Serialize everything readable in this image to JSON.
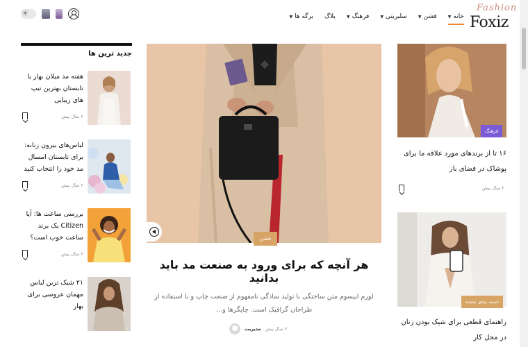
{
  "brand": {
    "logo_script": "Fashion",
    "logo_main": "Foxiz"
  },
  "nav": {
    "items": [
      {
        "label": "خانه",
        "has_dropdown": true,
        "active": true
      },
      {
        "label": "فشن",
        "has_dropdown": true,
        "active": false
      },
      {
        "label": "سلبریتی",
        "has_dropdown": true,
        "active": false
      },
      {
        "label": "فرهنگ",
        "has_dropdown": true,
        "active": false
      },
      {
        "label": "بلاگ",
        "has_dropdown": false,
        "active": false
      },
      {
        "label": "برگه ها",
        "has_dropdown": true,
        "active": false
      }
    ]
  },
  "sidebar": {
    "title": "جدید ترین ها",
    "items": [
      {
        "title": "هفته مد میلان بهار یا تابستان بهترین تیپ های زیبایی",
        "meta": "۲ سال پیش"
      },
      {
        "title": "لباس‌های بیرون زنانه: برای تابستان امسال مد خود را انتخاب کنید",
        "meta": "۲ سال پیش"
      },
      {
        "title": "بررسی ساعت ها: آیا Citizen یک برند ساعت خوب است؟",
        "meta": "۲ سال پیش"
      },
      {
        "title": "۲۱ شیک ترین لباس مهمان عروسی برای بهار",
        "meta": ""
      }
    ]
  },
  "feature": {
    "category": "فشن",
    "title": "هر آنچه که برای ورود به صنعت مد باید بدانید",
    "excerpt": "لورم ایپسوم متن ساختگی با تولید سادگی نامفهوم از صنعت چاپ و با استفاده از طراحان گرافیک است. چاپگرها و…",
    "author": "مدیریت",
    "meta": "۲ سال پیش"
  },
  "cards": [
    {
      "category": "فرهنگ",
      "category_color": "#7b5bd6",
      "title": "۱۶ تا از برندهای مورد علاقه ما برای پوشاک در فضای باز",
      "meta": "۲ سال پیش"
    },
    {
      "category": "دسته بندی نشده",
      "category_color": "#d8a466",
      "title": "راهنمای قطعی برای شیک بودن زنان در محل کار",
      "meta": ""
    }
  ],
  "colors": {
    "accent": "#e8883b",
    "fashion_tag": "#d8a466",
    "culture_tag": "#7b5bd6"
  }
}
